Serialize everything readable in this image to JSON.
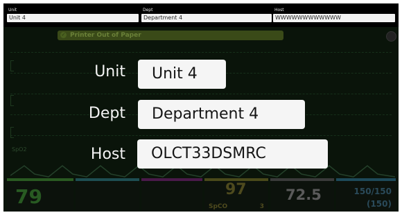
{
  "header": {
    "unit_label": "Unit",
    "unit_value": "Unit 4",
    "dept_label": "Dept",
    "dept_value": "Department 4",
    "host_label": "Host",
    "host_value": "WWWWWWWWWWWW"
  },
  "monitor": {
    "alarm_text": "Printer Out of Paper",
    "alarm_icon": "check-circle-icon",
    "trace_label": "SpO2",
    "tiles": {
      "hr_value": "79",
      "spo2_value": "97",
      "spo2_sub": "SpCO",
      "spo2_sub_value": "3",
      "temp_value": "72.5",
      "bp_value": "150/150",
      "bp_mean": "(150)"
    }
  },
  "overlay": {
    "unit_label": "Unit",
    "unit_value": "Unit 4",
    "dept_label": "Dept",
    "dept_value": "Department 4",
    "host_label": "Host",
    "host_value": "OLCT33DSMRC"
  },
  "colors": {
    "background": "#000000",
    "field_bg": "#f5f5f5",
    "hr_green": "#285a22",
    "spo2_yellow": "#4e4a1e"
  }
}
